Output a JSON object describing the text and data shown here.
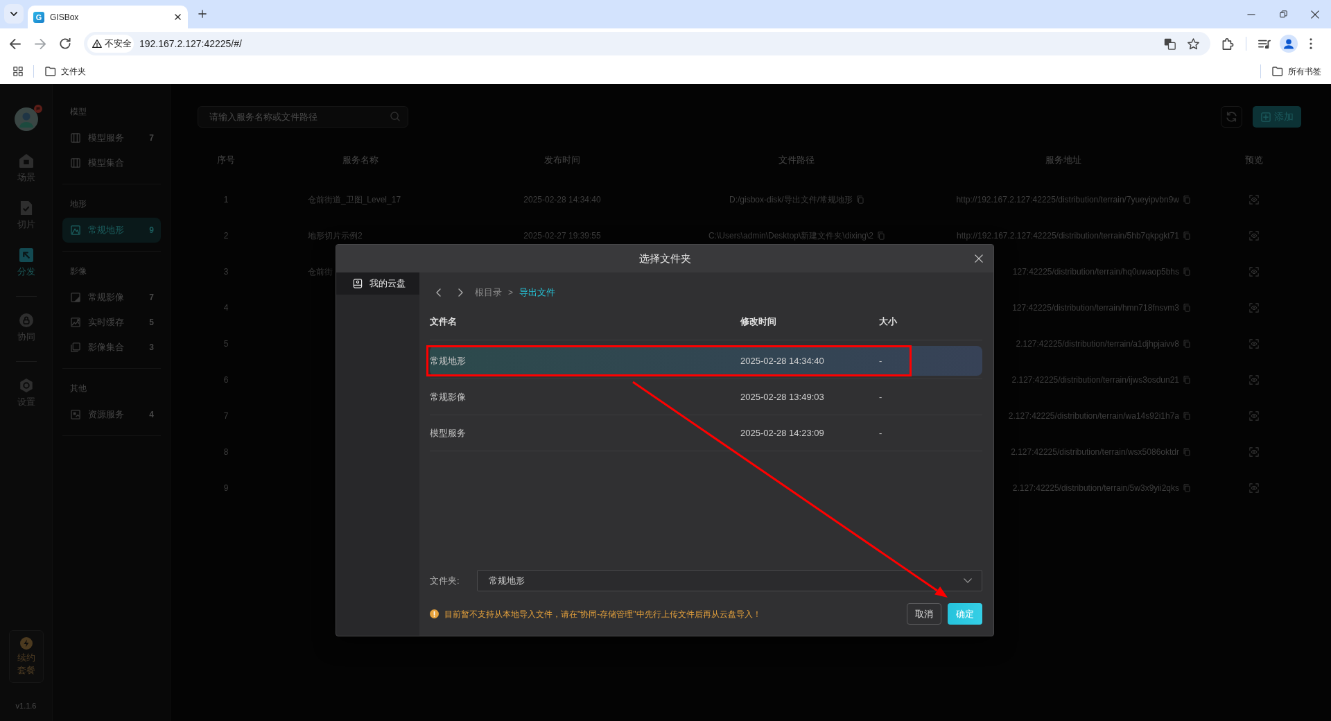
{
  "browser": {
    "tabs": [
      {
        "icon_letter": "G",
        "title": "GISBox",
        "selected": true
      }
    ],
    "security_chip": "不安全",
    "url": "192.167.2.127:42225/#/",
    "bookmarks": [
      {
        "label": "文件夹"
      }
    ],
    "all_bookmarks": "所有书签"
  },
  "rail": {
    "groups": [
      {
        "items": [
          {
            "kind": "scene",
            "label": "场景",
            "selected": false
          },
          {
            "kind": "tiles",
            "label": "切片",
            "selected": false
          },
          {
            "kind": "publish",
            "label": "分发",
            "selected": true
          }
        ]
      },
      {
        "items": [
          {
            "kind": "collab",
            "label": "协同",
            "selected": false
          }
        ]
      },
      {
        "items": [
          {
            "kind": "settings",
            "label": "设置",
            "selected": false
          }
        ]
      }
    ],
    "renew": "续约套餐",
    "version": "v1.1.6"
  },
  "sidebar": {
    "sections": [
      {
        "title": "模型",
        "items": [
          {
            "kind": "model",
            "label": "模型服务",
            "count": "7",
            "selected": false
          },
          {
            "kind": "model",
            "label": "模型集合",
            "selected": false
          }
        ]
      },
      {
        "title": "地形",
        "items": [
          {
            "kind": "terrain",
            "label": "常规地形",
            "count": "9",
            "selected": true
          }
        ]
      },
      {
        "title": "影像",
        "items": [
          {
            "kind": "imagery",
            "label": "常规影像",
            "count": "7",
            "selected": false
          },
          {
            "kind": "cache",
            "label": "实时缓存",
            "count": "5",
            "selected": false
          },
          {
            "kind": "collection",
            "label": "影像集合",
            "count": "3",
            "selected": false
          }
        ]
      },
      {
        "title": "其他",
        "items": [
          {
            "kind": "resource",
            "label": "资源服务",
            "count": "4",
            "selected": false
          }
        ]
      }
    ]
  },
  "main": {
    "search": {
      "placeholder": "请输入服务名称或文件路径"
    },
    "add_button": "添加",
    "table": {
      "columns": [
        "序号",
        "服务名称",
        "发布时间",
        "文件路径",
        "服务地址",
        "预览"
      ],
      "rows": [
        {
          "index": "1",
          "name": "仓前街道_卫图_Level_17",
          "published": "2025-02-28 14:34:40",
          "path": "D:/gisbox-disk/导出文件/常规地形",
          "address": "http://192.167.2.127:42225/distribution/terrain/7yueyipvbn9w"
        },
        {
          "index": "2",
          "name": "地形切片示例2",
          "published": "2025-02-27 19:39:55",
          "path": "C:\\Users\\admin\\Desktop\\新建文件夹\\dixing\\2",
          "address": "http://192.167.2.127:42225/distribution/terrain/5hb7qkpgkt71"
        },
        {
          "index": "3",
          "name": "仓前街",
          "address": "127:42225/distribution/terrain/hq0uwaop5bhs"
        },
        {
          "index": "4",
          "address": "127:42225/distribution/terrain/hmn718fnsvm3"
        },
        {
          "index": "5",
          "address": "2.127:42225/distribution/terrain/a1djhpjaivv8"
        },
        {
          "index": "6",
          "address": "2.127:42225/distribution/terrain/ijws3osdun21"
        },
        {
          "index": "7",
          "address": "2.127:42225/distribution/terrain/wa14s92i1h7a"
        },
        {
          "index": "8",
          "address": "2.127:42225/distribution/terrain/wsx5086oktdr"
        },
        {
          "index": "9",
          "address": "2.127:42225/distribution/terrain/5w3x9yii2qks"
        }
      ]
    }
  },
  "dialog": {
    "title": "选择文件夹",
    "sources": [
      {
        "label": "我的云盘",
        "selected": true
      }
    ],
    "breadcrumb": [
      {
        "label": "根目录",
        "selected": false
      },
      {
        "label": "导出文件",
        "selected": true
      }
    ],
    "breadcrumb_separator": ">",
    "columns": [
      "文件名",
      "修改时间",
      "大小"
    ],
    "rows": [
      {
        "name": "常规地形",
        "modified": "2025-02-28 14:34:40",
        "size": "-",
        "selected": true
      },
      {
        "name": "常规影像",
        "modified": "2025-02-28 13:49:03",
        "size": "-",
        "selected": false
      },
      {
        "name": "模型服务",
        "modified": "2025-02-28 14:23:09",
        "size": "-",
        "selected": false
      }
    ],
    "folder_field": {
      "label": "文件夹:",
      "value": "常规地形"
    },
    "notice": "目前暂不支持从本地导入文件，请在\"协同-存储管理\"中先行上传文件后再从云盘导入！",
    "buttons": [
      {
        "kind": "cancel",
        "label": "取消"
      },
      {
        "kind": "confirm",
        "label": "确定"
      }
    ]
  }
}
